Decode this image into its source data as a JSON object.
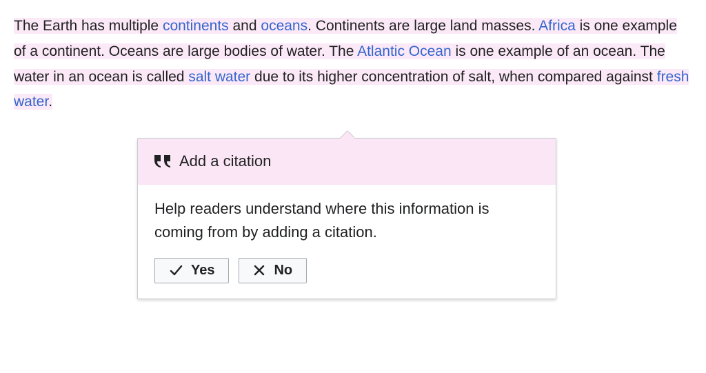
{
  "paragraph": {
    "segments": [
      {
        "text": "The Earth has multiple ",
        "link": false
      },
      {
        "text": "continents",
        "link": true
      },
      {
        "text": " and ",
        "link": false
      },
      {
        "text": "oceans",
        "link": true
      },
      {
        "text": ".  Continents are large land masses.  ",
        "link": false
      },
      {
        "text": "Africa",
        "link": true
      },
      {
        "text": " is one example of a continent.  Oceans are large bodies of water.  The ",
        "link": false
      },
      {
        "text": "Atlantic Ocean",
        "link": true
      },
      {
        "text": " is one example of an ocean.  The water in an ocean is called ",
        "link": false
      },
      {
        "text": "salt water",
        "link": true
      },
      {
        "text": " due to its higher concentration of salt, when compared against ",
        "link": false
      },
      {
        "text": "fresh water",
        "link": true
      },
      {
        "text": ".",
        "link": false
      }
    ]
  },
  "popover": {
    "title": "Add a citation",
    "body": "Help readers understand where this information is coming from by adding a citation.",
    "yes_label": "Yes",
    "no_label": "No"
  }
}
